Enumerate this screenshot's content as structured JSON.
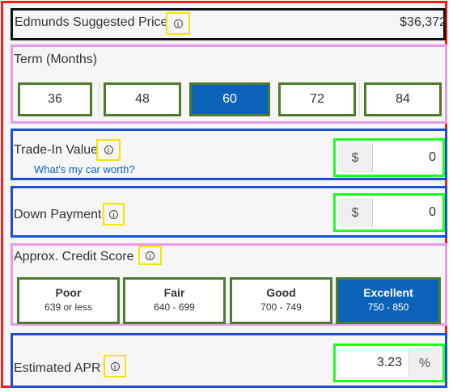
{
  "suggested_price": {
    "label": "Edmunds Suggested Price",
    "value": "$36,372",
    "info_icon": "info-icon"
  },
  "term": {
    "label": "Term (Months)",
    "options": [
      "36",
      "48",
      "60",
      "72",
      "84"
    ],
    "selected": "60"
  },
  "trade_in": {
    "label": "Trade-In Value",
    "link": "What's my car worth?",
    "currency": "$",
    "value": "0"
  },
  "down_payment": {
    "label": "Down Payment",
    "currency": "$",
    "value": "0"
  },
  "credit_score": {
    "label": "Approx. Credit Score",
    "options": [
      {
        "title": "Poor",
        "range": "639 or less"
      },
      {
        "title": "Fair",
        "range": "640 - 699"
      },
      {
        "title": "Good",
        "range": "700 - 749"
      },
      {
        "title": "Excellent",
        "range": "750 - 850"
      }
    ],
    "selected": "Excellent"
  },
  "apr": {
    "label": "Estimated APR",
    "value": "3.23",
    "unit": "%"
  },
  "colors": {
    "selected_blue": "#0a63b8",
    "outer_frame": "#ff1a1a",
    "section_blue": "#1b4fd6",
    "section_pink": "#e59be8",
    "button_green": "#4f7a2c",
    "input_green": "#1dff1d",
    "info_yellow": "#f2e600"
  }
}
